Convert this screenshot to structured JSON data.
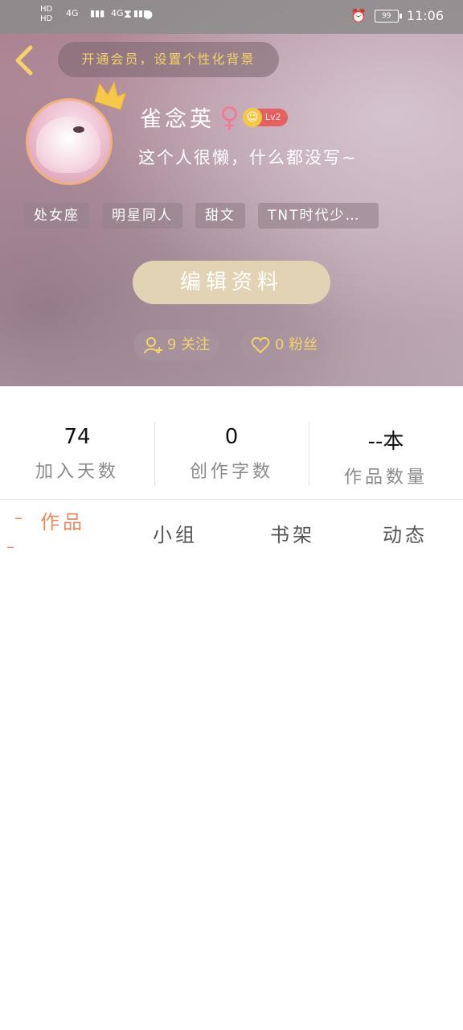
{
  "status_bar": {
    "hd1": "HD",
    "hd2": "HD",
    "net1": "4G",
    "net2": "4G",
    "battery": "99",
    "time": "11:06"
  },
  "header": {
    "vip_banner": "开通会员，设置个性化背景"
  },
  "profile": {
    "name": "雀念英",
    "gender_symbol": "♀",
    "level": "Lv2",
    "bio": "这个人很懒，什么都没写~",
    "tags": [
      "处女座",
      "明星同人",
      "甜文",
      "TNT时代少…"
    ]
  },
  "actions": {
    "edit_label": "编辑资料",
    "follow_label": "9 关注",
    "fans_label": "0 粉丝"
  },
  "stats": [
    {
      "value": "74",
      "label": "加入天数"
    },
    {
      "value": "0",
      "label": "创作字数"
    },
    {
      "value": "--本",
      "label": "作品数量"
    }
  ],
  "tabs": [
    {
      "label": "作品",
      "active": true
    },
    {
      "label": "小组",
      "active": false
    },
    {
      "label": "书架",
      "active": false
    },
    {
      "label": "动态",
      "active": false
    }
  ],
  "colors": {
    "accent": "#e48b5f",
    "vip_text": "#f3d36b",
    "level_badge": "#e36161"
  },
  "icons": [
    "back-arrow-icon",
    "crown-icon",
    "level-icon",
    "follow-user-icon",
    "heart-icon",
    "alarm-icon",
    "battery-icon",
    "signal-icon"
  ]
}
